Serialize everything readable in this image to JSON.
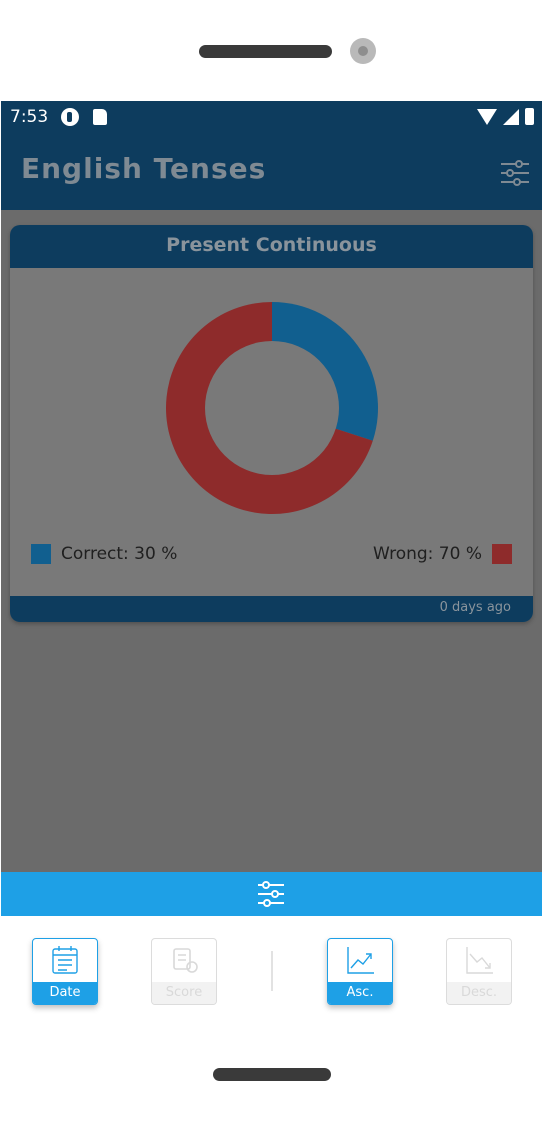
{
  "status_bar": {
    "time": "7:53",
    "icons": [
      "podcast-icon",
      "sd-card-icon",
      "wifi-icon",
      "signal-icon",
      "battery-icon"
    ]
  },
  "app_bar": {
    "title": "English Tenses",
    "action_icon": "filter-icon"
  },
  "card": {
    "title": "Present Continuous",
    "footer": "0 days ago",
    "legend": {
      "correct_label": "Correct: 30 %",
      "wrong_label": "Wrong: 70 %"
    }
  },
  "chart_data": {
    "type": "pie",
    "categories": [
      "Correct",
      "Wrong"
    ],
    "values": [
      30,
      70
    ],
    "colors": [
      "#115f8f",
      "#8e2b2b"
    ]
  },
  "bottom_sheet": {
    "toggle_icon": "filter-icon",
    "sort_options": [
      {
        "label": "Date",
        "icon": "calendar-icon",
        "active": true
      },
      {
        "label": "Score",
        "icon": "score-icon",
        "active": false
      },
      {
        "label": "Asc.",
        "icon": "chart-up-icon",
        "active": true
      },
      {
        "label": "Desc.",
        "icon": "chart-down-icon",
        "active": false
      }
    ]
  },
  "colors": {
    "primary_dark": "#0d3c5e",
    "accent": "#1ea0e6",
    "correct": "#115f8f",
    "wrong": "#8e2b2b",
    "overlay": "#6b6b6b"
  }
}
